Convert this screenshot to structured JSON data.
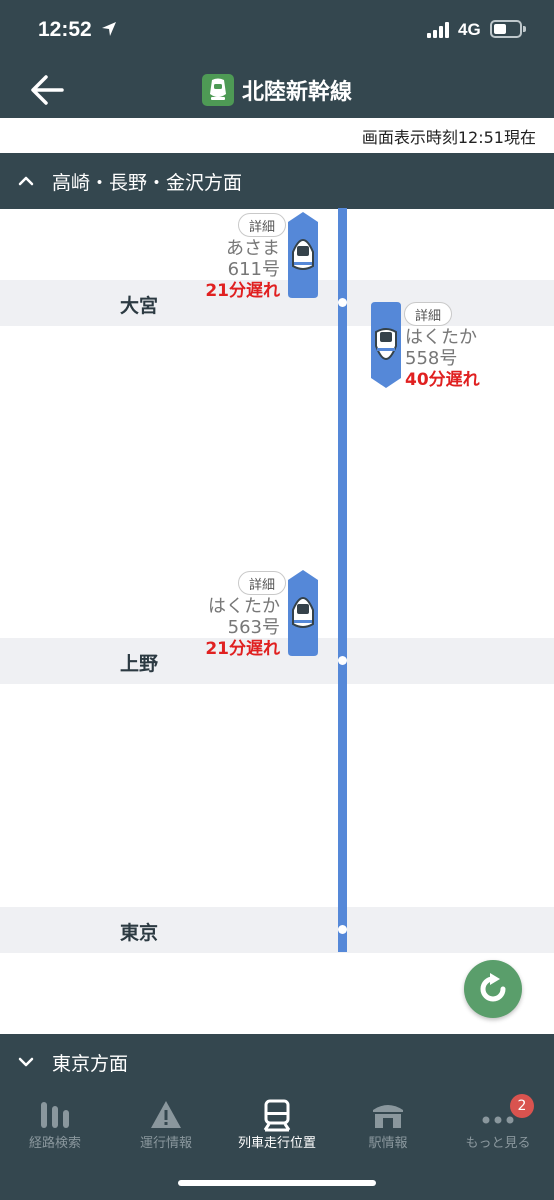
{
  "status_bar": {
    "time": "12:52",
    "network": "4G"
  },
  "header": {
    "title": "北陸新幹線"
  },
  "timestamp": "画面表示時刻12:51現在",
  "direction_top": {
    "label": "高崎・長野・金沢方面"
  },
  "direction_bottom": {
    "label": "東京方面"
  },
  "stations": [
    {
      "name": "大宮"
    },
    {
      "name": "上野"
    },
    {
      "name": "東京"
    }
  ],
  "trains": [
    {
      "detail_label": "詳細",
      "name": "あさま",
      "number": "611号",
      "delay": "21分遅れ"
    },
    {
      "detail_label": "詳細",
      "name": "はくたか",
      "number": "558号",
      "delay": "40分遅れ"
    },
    {
      "detail_label": "詳細",
      "name": "はくたか",
      "number": "563号",
      "delay": "21分遅れ"
    }
  ],
  "tabs": [
    {
      "label": "経路検索",
      "icon": "route-search-icon"
    },
    {
      "label": "運行情報",
      "icon": "warning-icon"
    },
    {
      "label": "列車走行位置",
      "icon": "train-icon"
    },
    {
      "label": "駅情報",
      "icon": "station-icon"
    },
    {
      "label": "もっと見る",
      "icon": "more-icon"
    }
  ],
  "more_badge": "2",
  "colors": {
    "header_bg": "#34474f",
    "track": "#5588d8",
    "delay": "#e02020",
    "refresh": "#5a9e6b",
    "line_icon": "#4e9a55"
  }
}
